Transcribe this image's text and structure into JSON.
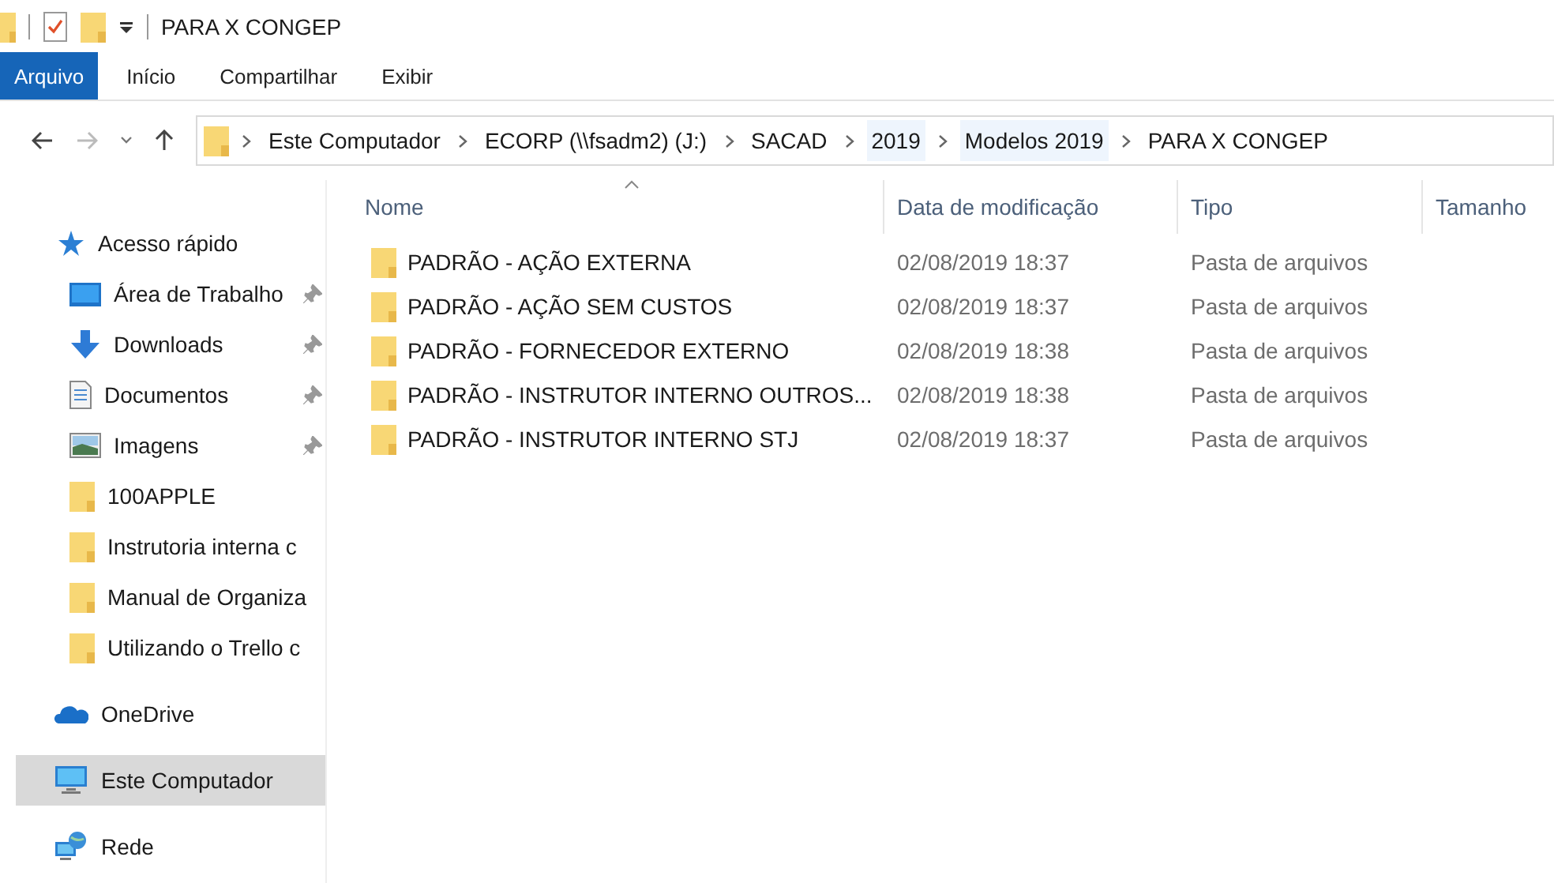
{
  "window": {
    "title": "PARA X CONGEP"
  },
  "ribbon_tabs": [
    {
      "label": "Arquivo",
      "selected": true
    },
    {
      "label": "Início",
      "selected": false
    },
    {
      "label": "Compartilhar",
      "selected": false
    },
    {
      "label": "Exibir",
      "selected": false
    }
  ],
  "breadcrumb": [
    {
      "label": "Este Computador",
      "highlighted": false
    },
    {
      "label": "ECORP (\\\\fsadm2) (J:)",
      "highlighted": false
    },
    {
      "label": "SACAD",
      "highlighted": false
    },
    {
      "label": "2019",
      "highlighted": true
    },
    {
      "label": "Modelos 2019",
      "highlighted": true
    },
    {
      "label": "PARA X CONGEP",
      "highlighted": false
    }
  ],
  "sidebar": {
    "items": [
      {
        "kind": "quick",
        "label": "Acesso rápido",
        "pinned": false,
        "selected": false
      },
      {
        "kind": "desktop",
        "label": "Área de Trabalho",
        "pinned": true,
        "selected": false
      },
      {
        "kind": "downloads",
        "label": "Downloads",
        "pinned": true,
        "selected": false
      },
      {
        "kind": "documents",
        "label": "Documentos",
        "pinned": true,
        "selected": false
      },
      {
        "kind": "images",
        "label": "Imagens",
        "pinned": true,
        "selected": false
      },
      {
        "kind": "folder",
        "label": "100APPLE",
        "pinned": false,
        "selected": false
      },
      {
        "kind": "folder",
        "label": "Instrutoria interna c",
        "pinned": false,
        "selected": false
      },
      {
        "kind": "folder",
        "label": "Manual de Organiza",
        "pinned": false,
        "selected": false
      },
      {
        "kind": "folder",
        "label": "Utilizando o Trello c",
        "pinned": false,
        "selected": false
      },
      {
        "kind": "onedrive",
        "label": "OneDrive",
        "pinned": false,
        "selected": false
      },
      {
        "kind": "computer",
        "label": "Este Computador",
        "pinned": false,
        "selected": true
      },
      {
        "kind": "network",
        "label": "Rede",
        "pinned": false,
        "selected": false
      }
    ]
  },
  "table": {
    "columns": [
      {
        "label": "Nome",
        "sorted": true
      },
      {
        "label": "Data de modificação",
        "sorted": false
      },
      {
        "label": "Tipo",
        "sorted": false
      },
      {
        "label": "Tamanho",
        "sorted": false
      }
    ],
    "rows": [
      {
        "name": "PADRÃO - AÇÃO EXTERNA",
        "date": "02/08/2019 18:37",
        "type": "Pasta de arquivos"
      },
      {
        "name": "PADRÃO - AÇÃO SEM CUSTOS",
        "date": "02/08/2019 18:37",
        "type": "Pasta de arquivos"
      },
      {
        "name": "PADRÃO - FORNECEDOR EXTERNO",
        "date": "02/08/2019 18:38",
        "type": "Pasta de arquivos"
      },
      {
        "name": "PADRÃO - INSTRUTOR INTERNO OUTROS...",
        "date": "02/08/2019 18:38",
        "type": "Pasta de arquivos"
      },
      {
        "name": "PADRÃO - INSTRUTOR INTERNO STJ",
        "date": "02/08/2019 18:37",
        "type": "Pasta de arquivos"
      }
    ]
  }
}
